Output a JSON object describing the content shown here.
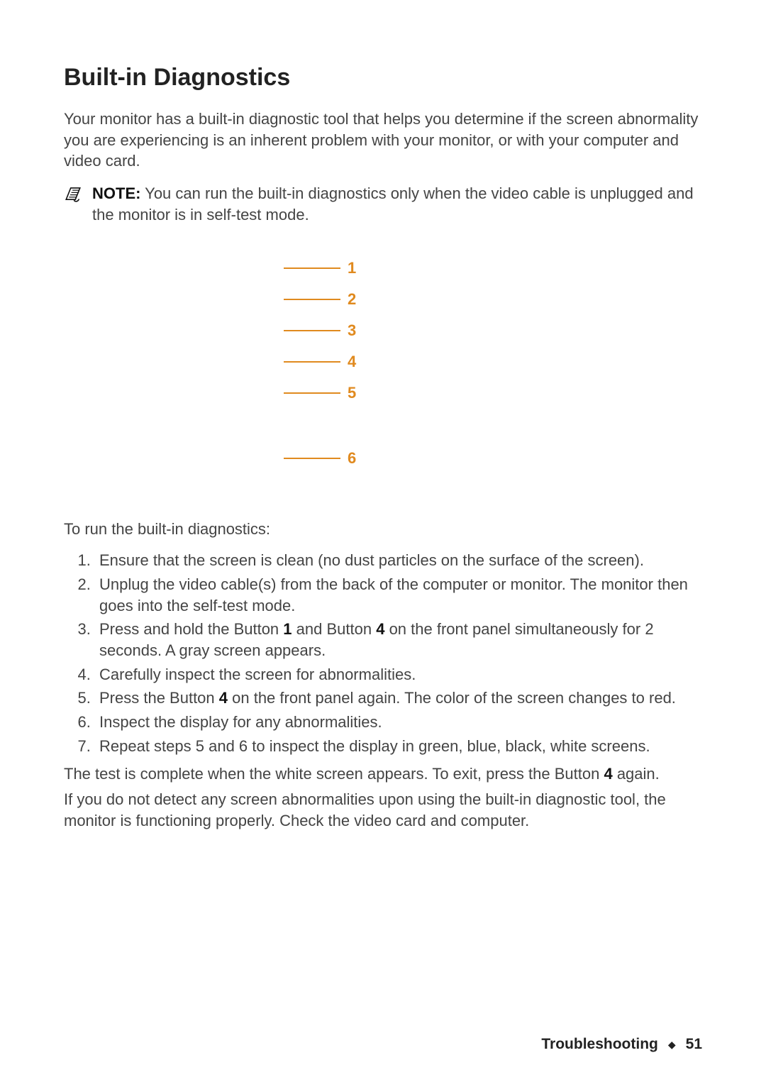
{
  "title": "Built-in Diagnostics",
  "intro": "Your monitor has a built-in diagnostic tool that helps you determine if the screen abnormality you are experiencing is an inherent problem with your monitor, or with your computer and video card.",
  "note": {
    "label": "NOTE:",
    "text": " You can run the built-in diagnostics only when the video cable is unplugged and the monitor is in self-test mode."
  },
  "diagram": {
    "labels": [
      "1",
      "2",
      "3",
      "4",
      "5",
      "6"
    ],
    "color": "#e08a1f"
  },
  "lead_in": "To run the built-in diagnostics:",
  "steps": [
    {
      "text": "Ensure that the screen is clean (no dust particles on the surface of the screen)."
    },
    {
      "text": "Unplug the video cable(s) from the back of the computer or monitor. The monitor then goes into the self-test mode."
    },
    {
      "html": "Press and hold the Button <b>1</b> and Button <b>4</b> on the front panel simultaneously for 2 seconds. A gray screen appears."
    },
    {
      "text": "Carefully inspect the screen for abnormalities."
    },
    {
      "html": "Press the Button <b>4</b> on the front panel again. The color of the screen changes to red."
    },
    {
      "text": "Inspect the display for any abnormalities."
    },
    {
      "text": "Repeat steps 5 and 6 to inspect the display in green, blue, black, white screens."
    }
  ],
  "closing1_html": "The test is complete when the white screen appears. To exit, press the Button <b>4</b> again.",
  "closing2": "If you do not detect any screen abnormalities upon using the built-in diagnostic tool, the monitor is functioning properly. Check the video card and computer.",
  "footer": {
    "section": "Troubleshooting",
    "page": "51"
  }
}
